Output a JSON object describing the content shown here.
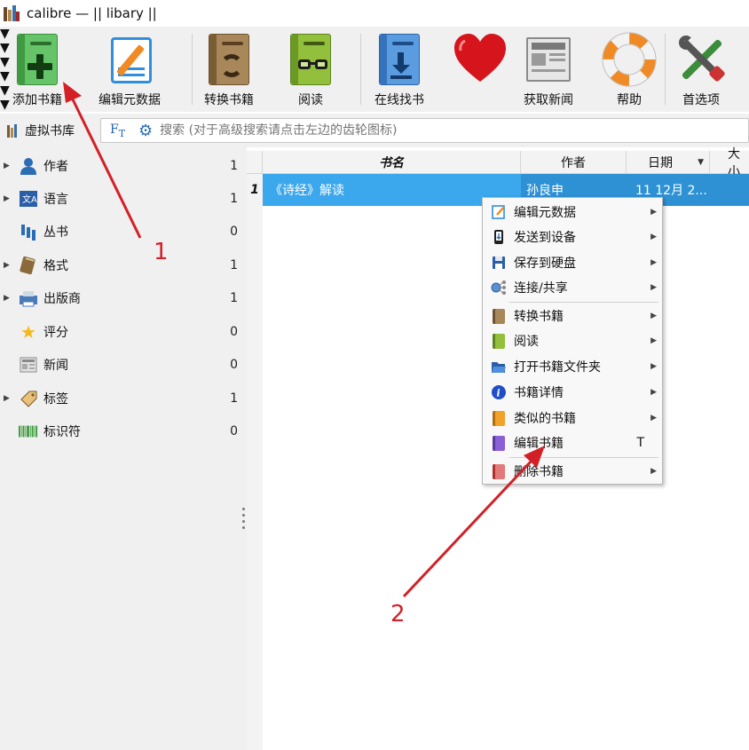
{
  "window": {
    "title": "calibre — || libary ||"
  },
  "toolbar": {
    "items": [
      {
        "label": "添加书籍",
        "icon": "add-book-icon",
        "color": "#5cb85c"
      },
      {
        "label": "编辑元数据",
        "icon": "edit-metadata-icon",
        "color": "#2f8fdc"
      },
      {
        "label": "转换书籍",
        "icon": "convert-book-icon",
        "color": "#9b7a4c"
      },
      {
        "label": "阅读",
        "icon": "read-book-icon",
        "color": "#8db83b"
      },
      {
        "label": "在线找书",
        "icon": "get-books-icon",
        "color": "#4c8fd6"
      },
      {
        "label": "",
        "icon": "donate-heart-icon",
        "color": "#d5141c"
      },
      {
        "label": "获取新闻",
        "icon": "fetch-news-icon",
        "color": "#8a8a8a"
      },
      {
        "label": "帮助",
        "icon": "help-lifebuoy-icon",
        "color": "#f08a24"
      },
      {
        "label": "首选项",
        "icon": "preferences-tools-icon",
        "color": "#3b8c3b"
      }
    ]
  },
  "search": {
    "virtual_library_label": "虚拟书库",
    "placeholder": "搜索 (对于高级搜索请点击左边的齿轮图标)"
  },
  "categories": [
    {
      "label": "作者",
      "count": "1",
      "expandable": true,
      "icon": "author-icon"
    },
    {
      "label": "语言",
      "count": "1",
      "expandable": true,
      "icon": "language-icon"
    },
    {
      "label": "丛书",
      "count": "0",
      "expandable": false,
      "icon": "series-icon"
    },
    {
      "label": "格式",
      "count": "1",
      "expandable": true,
      "icon": "format-icon"
    },
    {
      "label": "出版商",
      "count": "1",
      "expandable": true,
      "icon": "publisher-icon"
    },
    {
      "label": "评分",
      "count": "0",
      "expandable": false,
      "icon": "rating-star-icon"
    },
    {
      "label": "新闻",
      "count": "0",
      "expandable": false,
      "icon": "news-icon"
    },
    {
      "label": "标签",
      "count": "1",
      "expandable": true,
      "icon": "tag-icon"
    },
    {
      "label": "标识符",
      "count": "0",
      "expandable": false,
      "icon": "identifier-barcode-icon"
    }
  ],
  "table": {
    "headers": {
      "title": "书名",
      "author": "作者",
      "date": "日期",
      "size": "大小"
    },
    "rows": [
      {
        "num": "1",
        "title": "《诗经》解读",
        "author": "孙良申",
        "date": "11 12月 2..."
      }
    ]
  },
  "context_menu": {
    "items": [
      {
        "label": "编辑元数据",
        "icon": "edit-metadata-icon",
        "submenu": true,
        "shortcut": ""
      },
      {
        "label": "发送到设备",
        "icon": "send-to-device-icon",
        "submenu": true,
        "shortcut": ""
      },
      {
        "label": "保存到硬盘",
        "icon": "save-to-disk-icon",
        "submenu": true,
        "shortcut": ""
      },
      {
        "label": "连接/共享",
        "icon": "connect-share-icon",
        "submenu": true,
        "shortcut": ""
      },
      {
        "label": "转换书籍",
        "icon": "convert-book-icon",
        "submenu": true,
        "shortcut": ""
      },
      {
        "label": "阅读",
        "icon": "read-book-icon",
        "submenu": true,
        "shortcut": ""
      },
      {
        "label": "打开书籍文件夹",
        "icon": "open-folder-icon",
        "submenu": true,
        "shortcut": ""
      },
      {
        "label": "书籍详情",
        "icon": "book-details-icon",
        "submenu": true,
        "shortcut": ""
      },
      {
        "label": "类似的书籍",
        "icon": "similar-books-icon",
        "submenu": true,
        "shortcut": ""
      },
      {
        "label": "编辑书籍",
        "icon": "edit-book-icon",
        "submenu": false,
        "shortcut": "T"
      },
      {
        "label": "删除书籍",
        "icon": "remove-book-icon",
        "submenu": true,
        "shortcut": ""
      }
    ]
  },
  "annotations": {
    "step1": "1",
    "step2": "2",
    "color": "#d32027"
  }
}
